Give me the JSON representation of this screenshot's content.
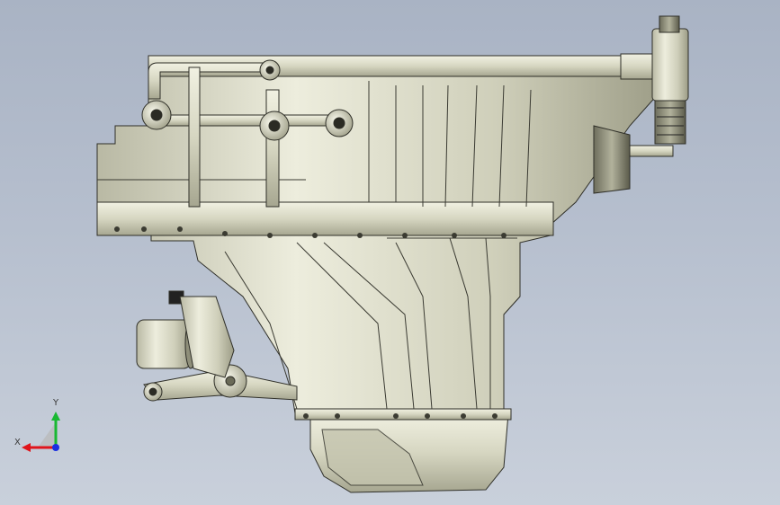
{
  "viewport": {
    "background_top": "#a9b3c4",
    "background_bottom": "#c9d0db",
    "model_fill": "#dcdcc8",
    "model_shadow": "#8f8f7a",
    "model_edge": "#2f2f28"
  },
  "triad": {
    "x_label": "X",
    "y_label": "Y",
    "x_color": "#e0141b",
    "y_color": "#19b832",
    "z_color": "#1b2fe0",
    "icon": "coordinate-triad-icon"
  }
}
